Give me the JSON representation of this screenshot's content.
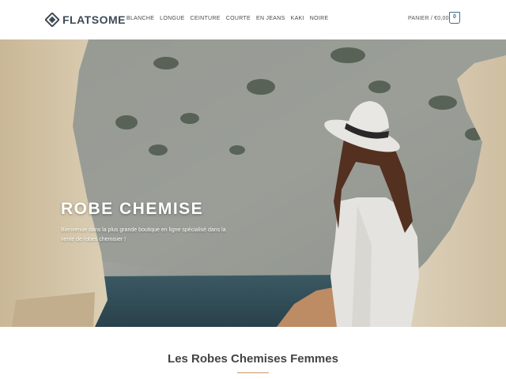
{
  "brand": {
    "name": "FLATSOME",
    "logo_icon": "tag-diamond-icon"
  },
  "nav": {
    "items": [
      {
        "label": "BLANCHE"
      },
      {
        "label": "LONGUE"
      },
      {
        "label": "CEINTURE"
      },
      {
        "label": "COURTE"
      },
      {
        "label": "EN JEANS"
      },
      {
        "label": "KAKI"
      },
      {
        "label": "NOIRE"
      }
    ]
  },
  "cart": {
    "label": "PANIER / €0,00",
    "count": "0",
    "icon": "shopping-bag-icon"
  },
  "hero": {
    "title": "ROBE CHEMISE",
    "subtitle": "Bienvenue dans la plus grande boutique en ligne spécialisé dans la vente de robes chemisier !"
  },
  "section": {
    "title": "Les Robes Chemises Femmes"
  },
  "colors": {
    "accent": "#3d6e8f",
    "divider": "#e2c3a8",
    "logo": "#3d4a56"
  }
}
